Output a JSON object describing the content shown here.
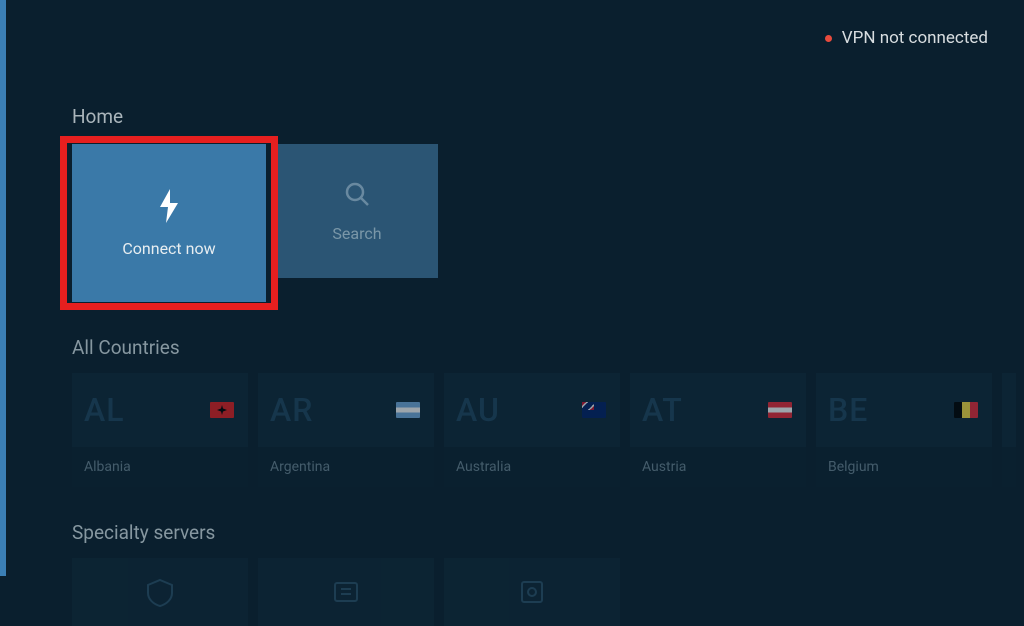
{
  "status": {
    "text": "VPN not connected"
  },
  "sections": {
    "home": {
      "title": "Home",
      "connect": "Connect now",
      "search": "Search"
    },
    "countries": {
      "title": "All Countries",
      "items": [
        {
          "code": "AL",
          "name": "Albania"
        },
        {
          "code": "AR",
          "name": "Argentina"
        },
        {
          "code": "AU",
          "name": "Australia"
        },
        {
          "code": "AT",
          "name": "Austria"
        },
        {
          "code": "BE",
          "name": "Belgium"
        }
      ]
    },
    "specialty": {
      "title": "Specialty servers"
    }
  }
}
